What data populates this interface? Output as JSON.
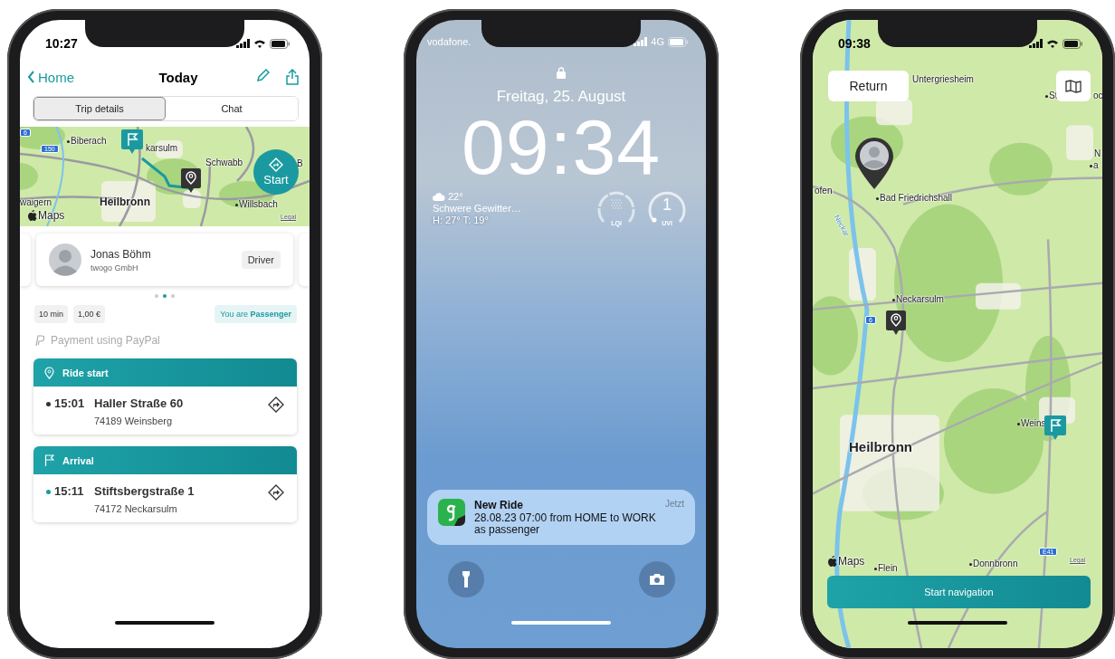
{
  "phones": [
    {
      "kind": "trip",
      "status_bar": {
        "time": "10:27"
      },
      "nav": {
        "back": "Home",
        "title": "Today"
      },
      "tabs": [
        {
          "label": "Trip details",
          "selected": true
        },
        {
          "label": "Chat",
          "selected": false
        }
      ],
      "map": {
        "labels": [
          {
            "kind": "shield",
            "text": "6"
          },
          {
            "kind": "shield",
            "text": "150"
          },
          {
            "kind": "place",
            "text": "Biberach"
          },
          {
            "kind": "town",
            "text": "karsulm"
          },
          {
            "kind": "town",
            "text": "Schwabb"
          },
          {
            "kind": "place",
            "text": "B"
          },
          {
            "kind": "town",
            "text": "waigern"
          },
          {
            "kind": "city",
            "text": "Heilbronn"
          },
          {
            "kind": "place",
            "text": "Willsbach"
          },
          {
            "kind": "brand",
            "text": "Maps"
          },
          {
            "kind": "legal",
            "text": "Legal"
          }
        ],
        "start_button": "Start"
      },
      "driver": {
        "name": "Jonas Böhm",
        "company": "twogo GmbH",
        "role": "Driver"
      },
      "pager": [
        {
          "selected": false
        },
        {
          "selected": true
        },
        {
          "selected": false
        }
      ],
      "chips": [
        "10 min",
        "1,00 €"
      ],
      "role_badge": "You are **Passenger**",
      "payment": "Payment using PayPal",
      "stops": [
        {
          "kind": "start",
          "header": "Ride start",
          "time": "15:01",
          "street": "Haller Straße 60",
          "city": "74189 Weinsberg",
          "color": "#333333"
        },
        {
          "kind": "arrival",
          "header": "Arrival",
          "time": "15:11",
          "street": "Stiftsbergstraße 1",
          "city": "74172 Neckarsulm",
          "color": "#1a9aa0"
        }
      ]
    },
    {
      "kind": "lock",
      "status_bar": {
        "carrier": "vodafone.",
        "network": "4G"
      },
      "date": "Freitag, 25. August",
      "time": "09:34",
      "weather": {
        "temp": "22°",
        "condition": "Schwere Gewitter…",
        "range": "H: 27° T: 19°"
      },
      "gauges": [
        {
          "kind": "air",
          "label": "LQI"
        },
        {
          "kind": "uv",
          "value": "1",
          "label": "UVI"
        }
      ],
      "notification": {
        "title": "New Ride",
        "text": "28.08.23 07:00 from HOME to WORK as passenger",
        "time": "Jetzt"
      }
    },
    {
      "kind": "map",
      "status_bar": {
        "time": "09:38"
      },
      "return_button": "Return",
      "map": {
        "labels": [
          {
            "kind": "town",
            "text": "Untergriesheim"
          },
          {
            "kind": "place",
            "text": "St"
          },
          {
            "kind": "town",
            "text": "oc"
          },
          {
            "kind": "town",
            "text": "N"
          },
          {
            "kind": "place",
            "text": "a"
          },
          {
            "kind": "town",
            "text": "ofen"
          },
          {
            "kind": "place",
            "text": "Bad Friedrichshall"
          },
          {
            "kind": "river",
            "text": "Neckar"
          },
          {
            "kind": "place",
            "text": "Neckarsulm"
          },
          {
            "kind": "shield",
            "text": "6"
          },
          {
            "kind": "place",
            "text": "Weins"
          },
          {
            "kind": "city",
            "text": "Heilbronn"
          },
          {
            "kind": "brand",
            "text": "Maps"
          },
          {
            "kind": "place",
            "text": "Flein"
          },
          {
            "kind": "place",
            "text": "Donnbronn"
          },
          {
            "kind": "shield",
            "text": "E41"
          },
          {
            "kind": "legal",
            "text": "Legal"
          }
        ]
      },
      "start_button": "Start navigation"
    }
  ]
}
